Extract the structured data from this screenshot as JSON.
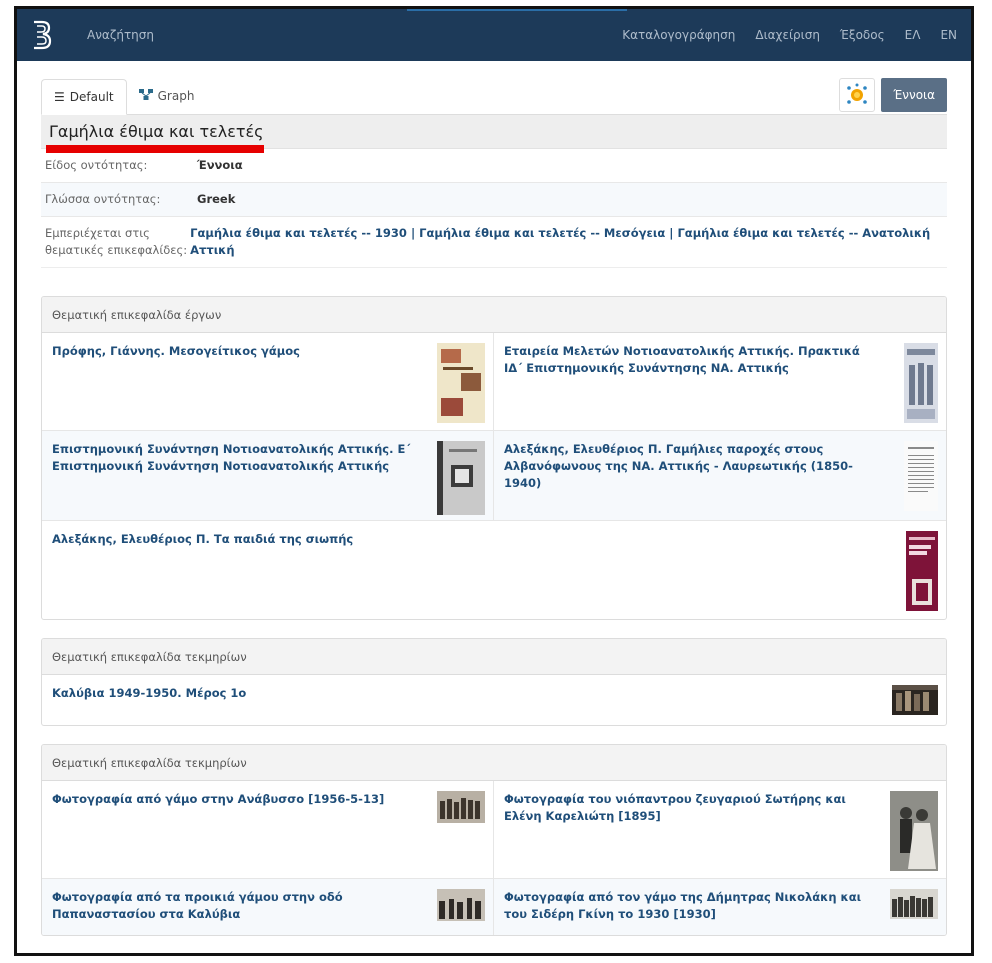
{
  "navbar": {
    "search": "Αναζήτηση",
    "links": [
      "Καταλογογράφηση",
      "Διαχείριση",
      "Έξοδος",
      "ΕΛ",
      "EN"
    ]
  },
  "tabs": [
    {
      "label": "Default",
      "icon": "list-icon"
    },
    {
      "label": "Graph",
      "icon": "graph-icon"
    }
  ],
  "entity_type_button": "Έννοια",
  "title": "Γαμήλια έθιμα και τελετές",
  "meta": {
    "kind_label": "Είδος οντότητας:",
    "kind_value": "Έννοια",
    "lang_label": "Γλώσσα οντότητας:",
    "lang_value": "Greek",
    "contained_label": "Εμπεριέχεται στις θεματικές επικεφαλίδες:",
    "contained_links": [
      "Γαμήλια έθιμα και τελετές -- 1930",
      "Γαμήλια έθιμα και τελετές -- Μεσόγεια",
      "Γαμήλια έθιμα και τελετές -- Ανατολική Αττική"
    ],
    "separator": "|"
  },
  "panels": {
    "works": {
      "heading": "Θεματική επικεφαλίδα έργων",
      "items": [
        {
          "text": "Πρόφης, Γιάννης. Μεσογείτικος γάμος"
        },
        {
          "text": "Εταιρεία Μελετών Νοτιοανατολικής Αττικής. Πρακτικά ΙΔ΄ Επιστημονικής Συνάντησης ΝΑ. Αττικής"
        },
        {
          "text": "Επιστημονική Συνάντηση Νοτιοανατολικής Αττικής. Ε΄ Επιστημονική Συνάντηση Νοτιοανατολικής Αττικής"
        },
        {
          "text": "Αλεξάκης, Ελευθέριος Π. Γαμήλιες παροχές στους Αλβανόφωνους της ΝΑ. Αττικής - Λαυρεωτικής (1850-1940)"
        },
        {
          "text": "Αλεξάκης, Ελευθέριος Π. Τα παιδιά της σιωπής"
        }
      ]
    },
    "records1": {
      "heading": "Θεματική επικεφαλίδα τεκμηρίων",
      "items": [
        {
          "text": "Καλύβια 1949-1950. Μέρος 1ο"
        }
      ]
    },
    "records2": {
      "heading": "Θεματική επικεφαλίδα τεκμηρίων",
      "items": [
        {
          "text": "Φωτογραφία από γάμο στην Ανάβυσσο [1956-5-13]"
        },
        {
          "text": "Φωτογραφία του νιόπαντρου ζευγαριού Σωτήρης και Ελένη Καρελιώτη [1895]"
        },
        {
          "text": "Φωτογραφία από τα προικιά γάμου στην οδό Παπαναστασίου στα Καλύβια"
        },
        {
          "text": "Φωτογραφία από τον γάμο της Δήμητρας Νικολάκη και του Σιδέρη Γκίνη το 1930 [1930]"
        }
      ]
    }
  },
  "colors": {
    "navbar": "#1d3a59",
    "link": "#1f4e79",
    "type_button": "#5a6f86",
    "highlight": "#e60000"
  }
}
